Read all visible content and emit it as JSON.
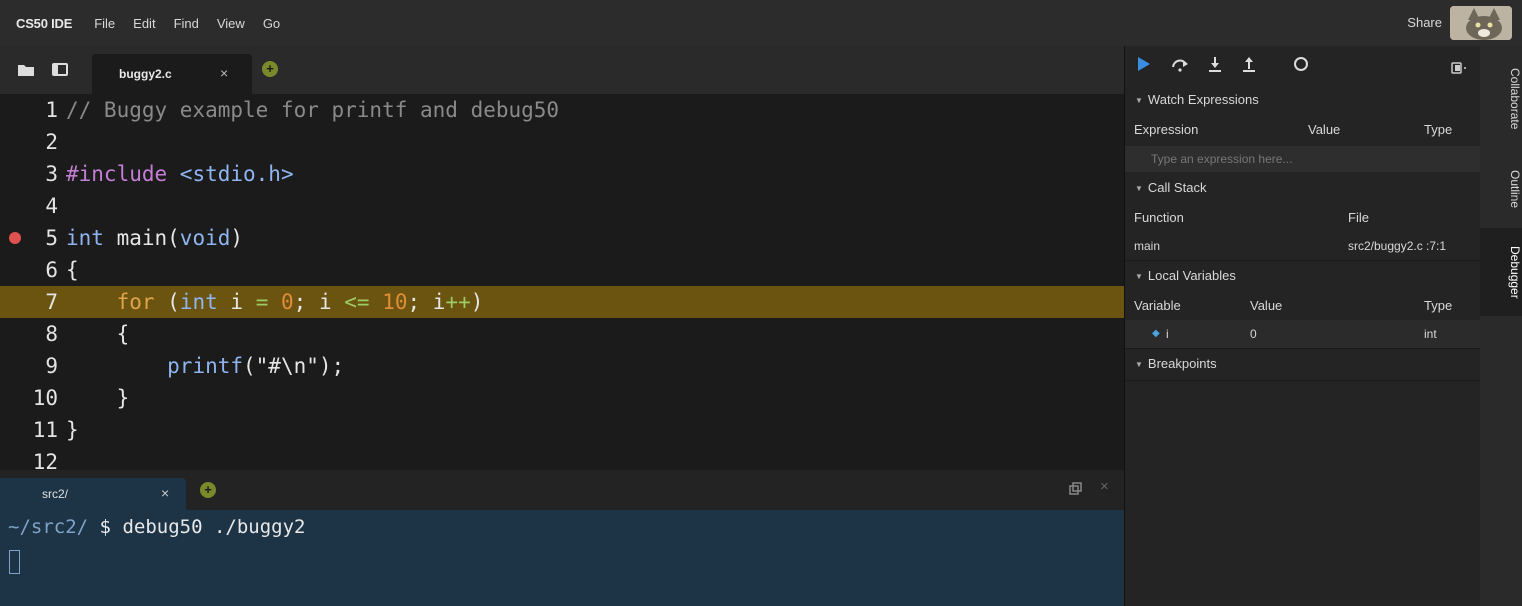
{
  "menubar": {
    "brand": "CS50 IDE",
    "items": [
      "File",
      "Edit",
      "Find",
      "View",
      "Go"
    ],
    "share": "Share"
  },
  "editor": {
    "tab_label": "buggy2.c",
    "tab_close": "×",
    "add_tab": "+",
    "lines": [
      {
        "n": "1",
        "tokens": [
          [
            "cm",
            "// Buggy example for printf and debug50"
          ]
        ]
      },
      {
        "n": "2",
        "tokens": []
      },
      {
        "n": "3",
        "tokens": [
          [
            "pp",
            "#include "
          ],
          [
            "inc",
            "<stdio.h>"
          ]
        ]
      },
      {
        "n": "4",
        "tokens": []
      },
      {
        "n": "5",
        "tokens": [
          [
            "kw",
            "int"
          ],
          [
            "",
            " main("
          ],
          [
            "kw",
            "void"
          ],
          [
            "",
            ")"
          ]
        ],
        "breakpoint": true
      },
      {
        "n": "6",
        "tokens": [
          [
            "",
            "{"
          ]
        ]
      },
      {
        "n": "7",
        "tokens": [
          [
            "",
            "    "
          ],
          [
            "kw2",
            "for"
          ],
          [
            "",
            " ("
          ],
          [
            "kw",
            "int"
          ],
          [
            "",
            " i "
          ],
          [
            "op",
            "="
          ],
          [
            "",
            " "
          ],
          [
            "num",
            "0"
          ],
          [
            "",
            "; i "
          ],
          [
            "op",
            "<="
          ],
          [
            "",
            " "
          ],
          [
            "num",
            "10"
          ],
          [
            "",
            "; i"
          ],
          [
            "op",
            "++"
          ],
          [
            "",
            ")"
          ]
        ],
        "active": true
      },
      {
        "n": "8",
        "tokens": [
          [
            "",
            "    {"
          ]
        ]
      },
      {
        "n": "9",
        "tokens": [
          [
            "",
            "        "
          ],
          [
            "fn",
            "printf"
          ],
          [
            "",
            "(\"#\\n\");"
          ]
        ]
      },
      {
        "n": "10",
        "tokens": [
          [
            "",
            "    }"
          ]
        ]
      },
      {
        "n": "11",
        "tokens": [
          [
            "",
            "}"
          ]
        ]
      },
      {
        "n": "12",
        "tokens": []
      }
    ]
  },
  "terminal": {
    "tab_label": "src2/",
    "tab_close": "×",
    "add_tab": "+",
    "path": "~/src2/",
    "dollar": "$",
    "command": "debug50 ./buggy2"
  },
  "debugger": {
    "watch": {
      "title": "Watch Expressions",
      "columns": [
        "Expression",
        "Value",
        "Type"
      ],
      "placeholder": "Type an expression here..."
    },
    "call_stack": {
      "title": "Call Stack",
      "columns": [
        "Function",
        "File"
      ],
      "rows": [
        {
          "function": "main",
          "file": "src2/buggy2.c :7:1"
        }
      ]
    },
    "locals": {
      "title": "Local Variables",
      "columns": [
        "Variable",
        "Value",
        "Type"
      ],
      "rows": [
        {
          "variable": "i",
          "value": "0",
          "type": "int"
        }
      ]
    },
    "breakpoints": {
      "title": "Breakpoints"
    }
  },
  "side_tabs": [
    "Collaborate",
    "Outline",
    "Debugger"
  ],
  "colors": {
    "active_line": "#6b5410",
    "breakpoint": "#e05252",
    "terminal_bg": "#1d3447",
    "play_button": "#3b8de0"
  }
}
